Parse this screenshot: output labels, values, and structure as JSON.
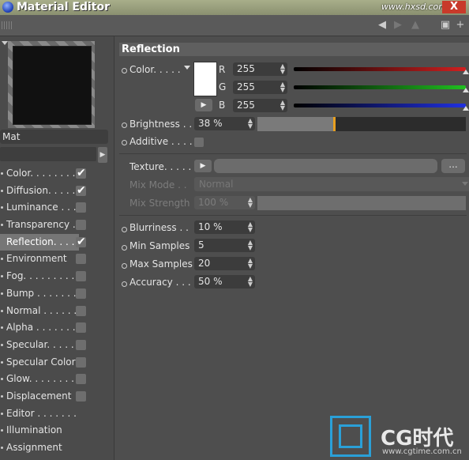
{
  "window": {
    "title": "Material Editor",
    "close_glyph": "X",
    "watermark": "www.hxsd.com"
  },
  "preview": {
    "name": "Mat"
  },
  "channels": [
    {
      "label": "Color. . . . . . . .",
      "checked": true,
      "has_check": true
    },
    {
      "label": "Diffusion. . . . . .",
      "checked": true,
      "has_check": true
    },
    {
      "label": "Luminance . . . .",
      "checked": false,
      "has_check": true
    },
    {
      "label": "Transparency . .",
      "checked": false,
      "has_check": true
    },
    {
      "label": "Reflection. . . . .",
      "checked": true,
      "has_check": true,
      "selected": true
    },
    {
      "label": "Environment",
      "checked": false,
      "has_check": true
    },
    {
      "label": "Fog. . . . . . . . . .",
      "checked": false,
      "has_check": true
    },
    {
      "label": "Bump . . . . . . . .",
      "checked": false,
      "has_check": true
    },
    {
      "label": "Normal . . . . . . .",
      "checked": false,
      "has_check": true
    },
    {
      "label": "Alpha . . . . . . . .",
      "checked": false,
      "has_check": true
    },
    {
      "label": "Specular. . . . . .",
      "checked": false,
      "has_check": true
    },
    {
      "label": "Specular Color",
      "checked": false,
      "has_check": true
    },
    {
      "label": "Glow. . . . . . . . .",
      "checked": false,
      "has_check": true
    },
    {
      "label": "Displacement",
      "checked": false,
      "has_check": true
    },
    {
      "label": "Editor . . . . . . .",
      "checked": false,
      "has_check": false
    },
    {
      "label": "Illumination",
      "checked": false,
      "has_check": false
    },
    {
      "label": "Assignment",
      "checked": false,
      "has_check": false
    }
  ],
  "reflection": {
    "section_title": "Reflection",
    "color_label": "Color. . . . .",
    "r_label": "R",
    "g_label": "G",
    "b_label": "B",
    "r": "255",
    "g": "255",
    "b": "255",
    "brightness_label": "Brightness . .",
    "brightness": "38 %",
    "brightness_fraction": 0.38,
    "additive_label": "Additive . . . .",
    "texture_label": "Texture. . . . .",
    "texture_dots": "...",
    "mix_mode_label": "Mix Mode . .",
    "mix_mode": "Normal",
    "mix_strength_label": "Mix Strength",
    "mix_strength": "100 %",
    "blurriness_label": "Blurriness . .",
    "blurriness": "10 %",
    "min_samples_label": "Min Samples",
    "min_samples": "5",
    "max_samples_label": "Max Samples",
    "max_samples": "20",
    "accuracy_label": "Accuracy . . .",
    "accuracy": "50 %"
  },
  "branding": {
    "logo_text": "CG时代",
    "url": "www.cgtime.com.cn"
  },
  "colors": {
    "red": "#d02020",
    "green": "#20b020",
    "blue": "#2030d0",
    "accent": "#e8a020"
  }
}
